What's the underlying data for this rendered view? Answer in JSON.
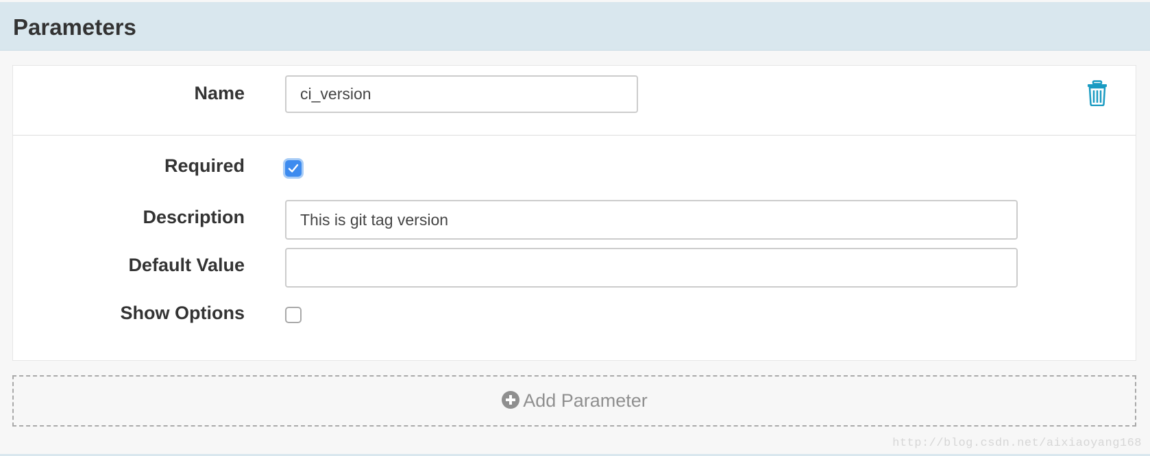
{
  "panel": {
    "title": "Parameters"
  },
  "parameter": {
    "name_label": "Name",
    "name_value": "ci_version",
    "required_label": "Required",
    "required_checked": true,
    "description_label": "Description",
    "description_value": "This is git tag version",
    "default_value_label": "Default Value",
    "default_value": "",
    "show_options_label": "Show Options",
    "show_options_checked": false,
    "delete_icon": "trash-icon"
  },
  "add_parameter": {
    "label": "Add Parameter",
    "icon": "plus-circle-icon"
  },
  "watermark": {
    "text": "http://blog.csdn.net/aixiaoyang168"
  },
  "colors": {
    "header_bg": "#d9e7ee",
    "accent": "#1a9bc2",
    "checkbox_checked": "#3d8bef"
  }
}
